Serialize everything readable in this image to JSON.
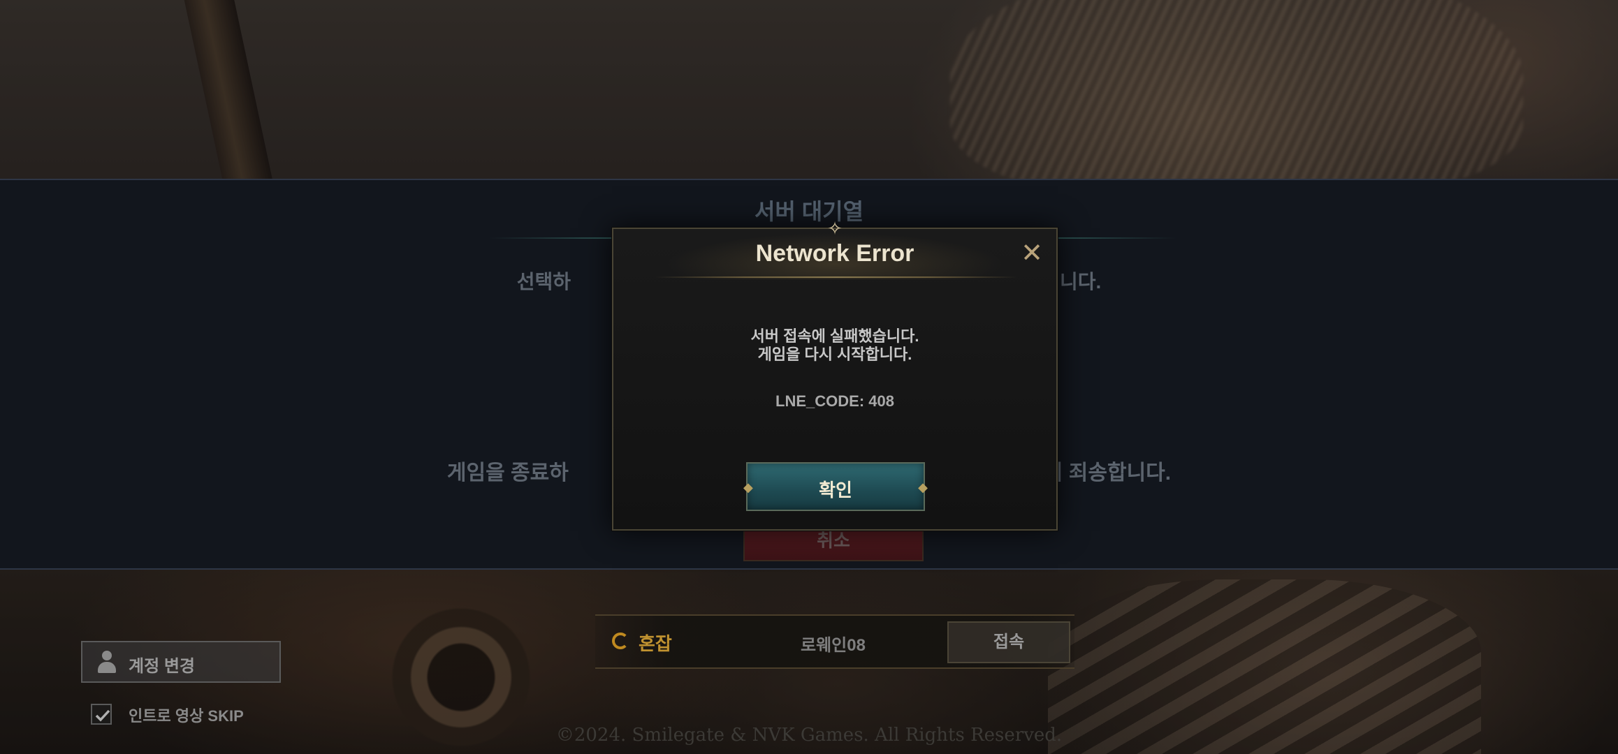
{
  "queue": {
    "title": "서버 대기열",
    "message_top_left": "선택하",
    "message_top_right": "니다.",
    "message_bottom_left": "게임을 종료하",
    "message_bottom_right": "려 죄송합니다.",
    "cancel_label": "취소"
  },
  "modal": {
    "title": "Network Error",
    "message_line1": "서버 접속에 실패했습니다.",
    "message_line2": "게임을 다시 시작합니다.",
    "code": "LNE_CODE: 408",
    "confirm_label": "확인",
    "close_icon": "close-icon"
  },
  "account": {
    "change_label": "계정 변경",
    "icon": "user-icon"
  },
  "intro_skip": {
    "label": "인트로 영상 SKIP",
    "checked": true
  },
  "server": {
    "status_label": "혼잡",
    "status_color": "#c09230",
    "name": "로웨인08",
    "connect_label": "접속"
  },
  "copyright": "©2024. Smilegate & NVK Games. All Rights Reserved."
}
